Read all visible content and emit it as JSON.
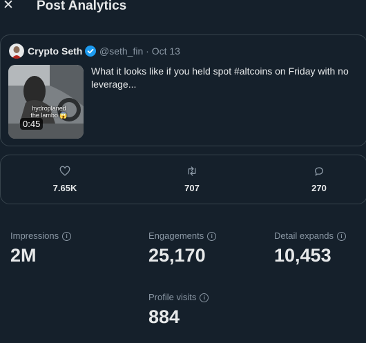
{
  "header": {
    "close_symbol": "✕",
    "title": "Post Analytics"
  },
  "post": {
    "author_name": "Crypto Seth",
    "handle_date": "@seth_fin · Oct 13",
    "text": "What it looks like if you held spot #altcoins on Friday with no leverage...",
    "media_caption": "hydroplaned the lambo 😱",
    "media_duration": "0:45",
    "verified_color": "#1d9bf0"
  },
  "engagement_bar": {
    "likes": {
      "icon": "heart-icon",
      "count": "7.65K"
    },
    "reposts": {
      "icon": "repost-icon",
      "count": "707"
    },
    "replies": {
      "icon": "reply-icon",
      "count": "270"
    }
  },
  "stats": {
    "impressions": {
      "label": "Impressions",
      "value": "2M"
    },
    "engagements": {
      "label": "Engagements",
      "value": "25,170"
    },
    "detail_expands": {
      "label": "Detail expands",
      "value": "10,453"
    },
    "profile_visits": {
      "label": "Profile visits",
      "value": "884"
    },
    "info_symbol": "i"
  },
  "colors": {
    "background": "#15202b",
    "border": "#38444d",
    "secondary_text": "#8b98a5"
  }
}
